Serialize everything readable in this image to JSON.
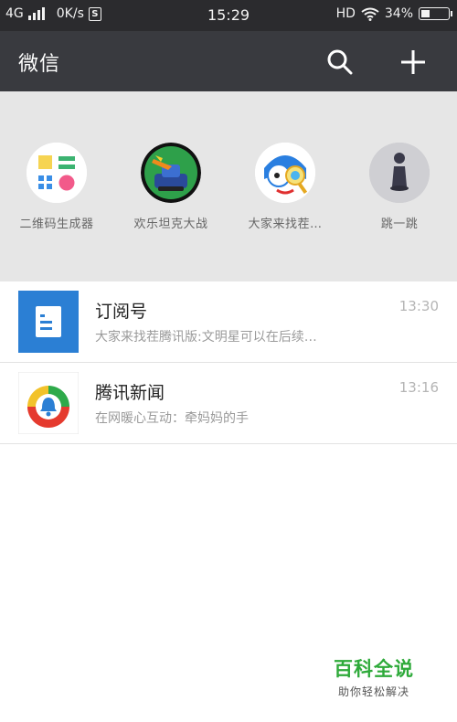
{
  "status_bar": {
    "network": "4G",
    "speed": "0K/s",
    "s_badge": "S",
    "time": "15:29",
    "hd": "HD",
    "battery": "34%",
    "battery_level": 0.34
  },
  "header": {
    "title": "微信",
    "search_icon": "search-icon",
    "add_icon": "plus-icon"
  },
  "mini_apps": [
    {
      "label": "二维码生成器",
      "icon": "qr-generator-icon"
    },
    {
      "label": "欢乐坦克大战",
      "icon": "tank-battle-icon"
    },
    {
      "label": "大家来找茬…",
      "icon": "find-difference-icon"
    },
    {
      "label": "跳一跳",
      "icon": "jump-jump-icon"
    }
  ],
  "chats": [
    {
      "name": "订阅号",
      "time": "13:30",
      "preview": "大家来找茬腾讯版:文明星可以在后续…",
      "icon": "subscription-icon"
    },
    {
      "name": "腾讯新闻",
      "time": "13:16",
      "preview": "在网暖心互动：牵妈妈的手",
      "icon": "tencent-news-icon"
    }
  ],
  "watermark": {
    "title": "百科全说",
    "subtitle": "助你轻松解决"
  },
  "colors": {
    "status_bar": "#2b2b2e",
    "title_bar": "#393a3f",
    "apps_background": "#e6e6e6",
    "subscription_blue": "#2b7fd4",
    "watermark_green": "#2eaa3a"
  }
}
